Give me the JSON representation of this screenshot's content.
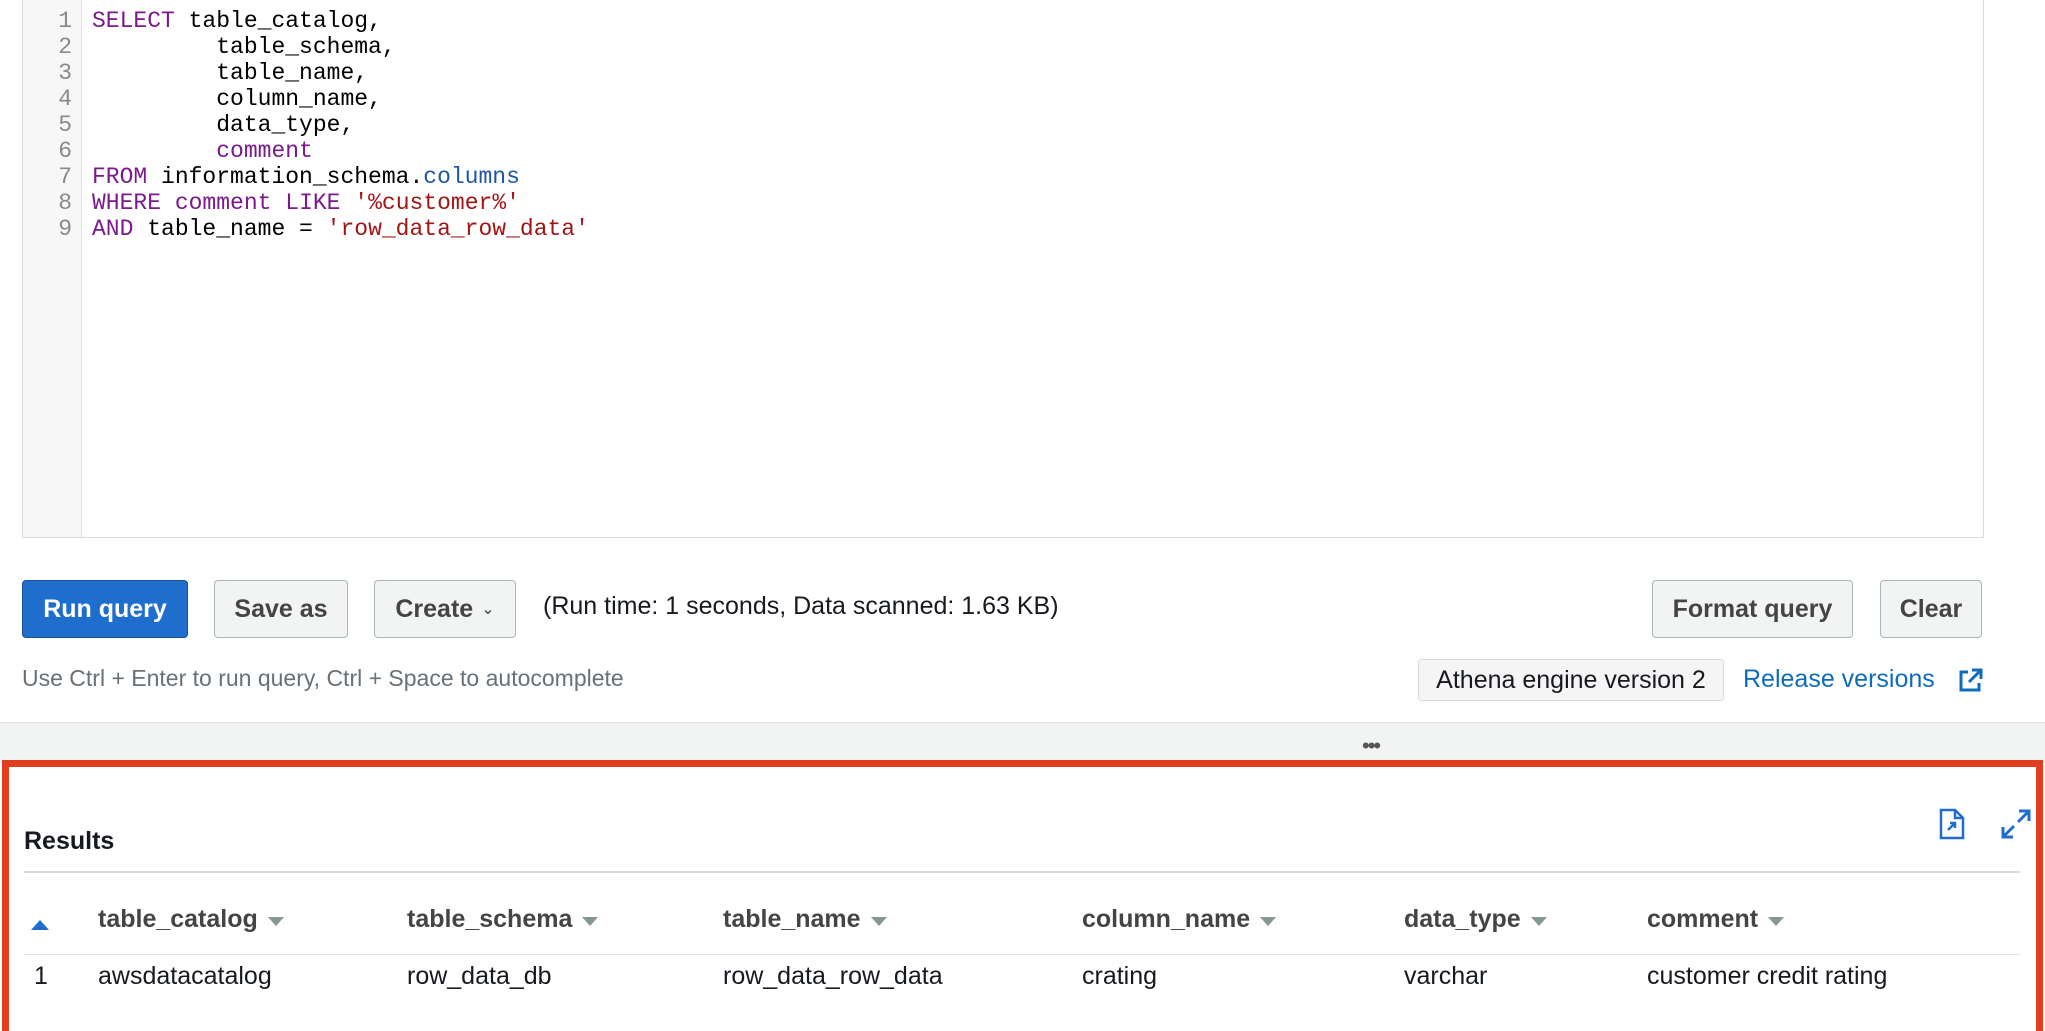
{
  "editor": {
    "line_numbers": [
      "1",
      "2",
      "3",
      "4",
      "5",
      "6",
      "7",
      "8",
      "9"
    ],
    "lines": [
      {
        "indent": "",
        "tokens": [
          {
            "t": "kw",
            "v": "SELECT"
          },
          {
            "t": "tx",
            "v": " table_catalog,"
          }
        ]
      },
      {
        "indent": "         ",
        "tokens": [
          {
            "t": "tx",
            "v": "table_schema,"
          }
        ]
      },
      {
        "indent": "         ",
        "tokens": [
          {
            "t": "tx",
            "v": "table_name,"
          }
        ]
      },
      {
        "indent": "         ",
        "tokens": [
          {
            "t": "tx",
            "v": "column_name,"
          }
        ]
      },
      {
        "indent": "         ",
        "tokens": [
          {
            "t": "tx",
            "v": "data_type,"
          }
        ]
      },
      {
        "indent": "         ",
        "tokens": [
          {
            "t": "kw",
            "v": "comment"
          }
        ]
      },
      {
        "indent": "",
        "tokens": [
          {
            "t": "kw",
            "v": "FROM"
          },
          {
            "t": "tx",
            "v": " information_schema."
          },
          {
            "t": "fn",
            "v": "columns"
          }
        ]
      },
      {
        "indent": "",
        "tokens": [
          {
            "t": "kw",
            "v": "WHERE"
          },
          {
            "t": "tx",
            "v": " "
          },
          {
            "t": "kw",
            "v": "comment"
          },
          {
            "t": "tx",
            "v": " "
          },
          {
            "t": "kw",
            "v": "LIKE"
          },
          {
            "t": "tx",
            "v": " "
          },
          {
            "t": "str",
            "v": "'%customer%'"
          }
        ]
      },
      {
        "indent": "",
        "tokens": [
          {
            "t": "kw",
            "v": "AND"
          },
          {
            "t": "tx",
            "v": " table_name = "
          },
          {
            "t": "str",
            "v": "'row_data_row_data'"
          }
        ]
      }
    ]
  },
  "toolbar": {
    "run_label": "Run query",
    "save_as_label": "Save as",
    "create_label": "Create",
    "run_info": "(Run time: 1 seconds, Data scanned: 1.63 KB)",
    "format_label": "Format query",
    "clear_label": "Clear",
    "hint": "Use Ctrl + Enter to run query, Ctrl + Space to autocomplete",
    "engine_version": "Athena engine version 2",
    "release_label": "Release versions"
  },
  "splitter": {
    "handle": "•••"
  },
  "results": {
    "title": "Results",
    "columns": [
      "table_catalog",
      "table_schema",
      "table_name",
      "column_name",
      "data_type",
      "comment"
    ],
    "rows": [
      {
        "index": "1",
        "cells": [
          "awsdatacatalog",
          "row_data_db",
          "row_data_row_data",
          "crating",
          "varchar",
          "customer credit rating"
        ]
      }
    ]
  },
  "colors": {
    "primary": "#1f6dcc",
    "link": "#0f6cbd",
    "highlight_border": "#e03e1f",
    "keyword": "#7a1a8b",
    "string": "#a31515"
  }
}
